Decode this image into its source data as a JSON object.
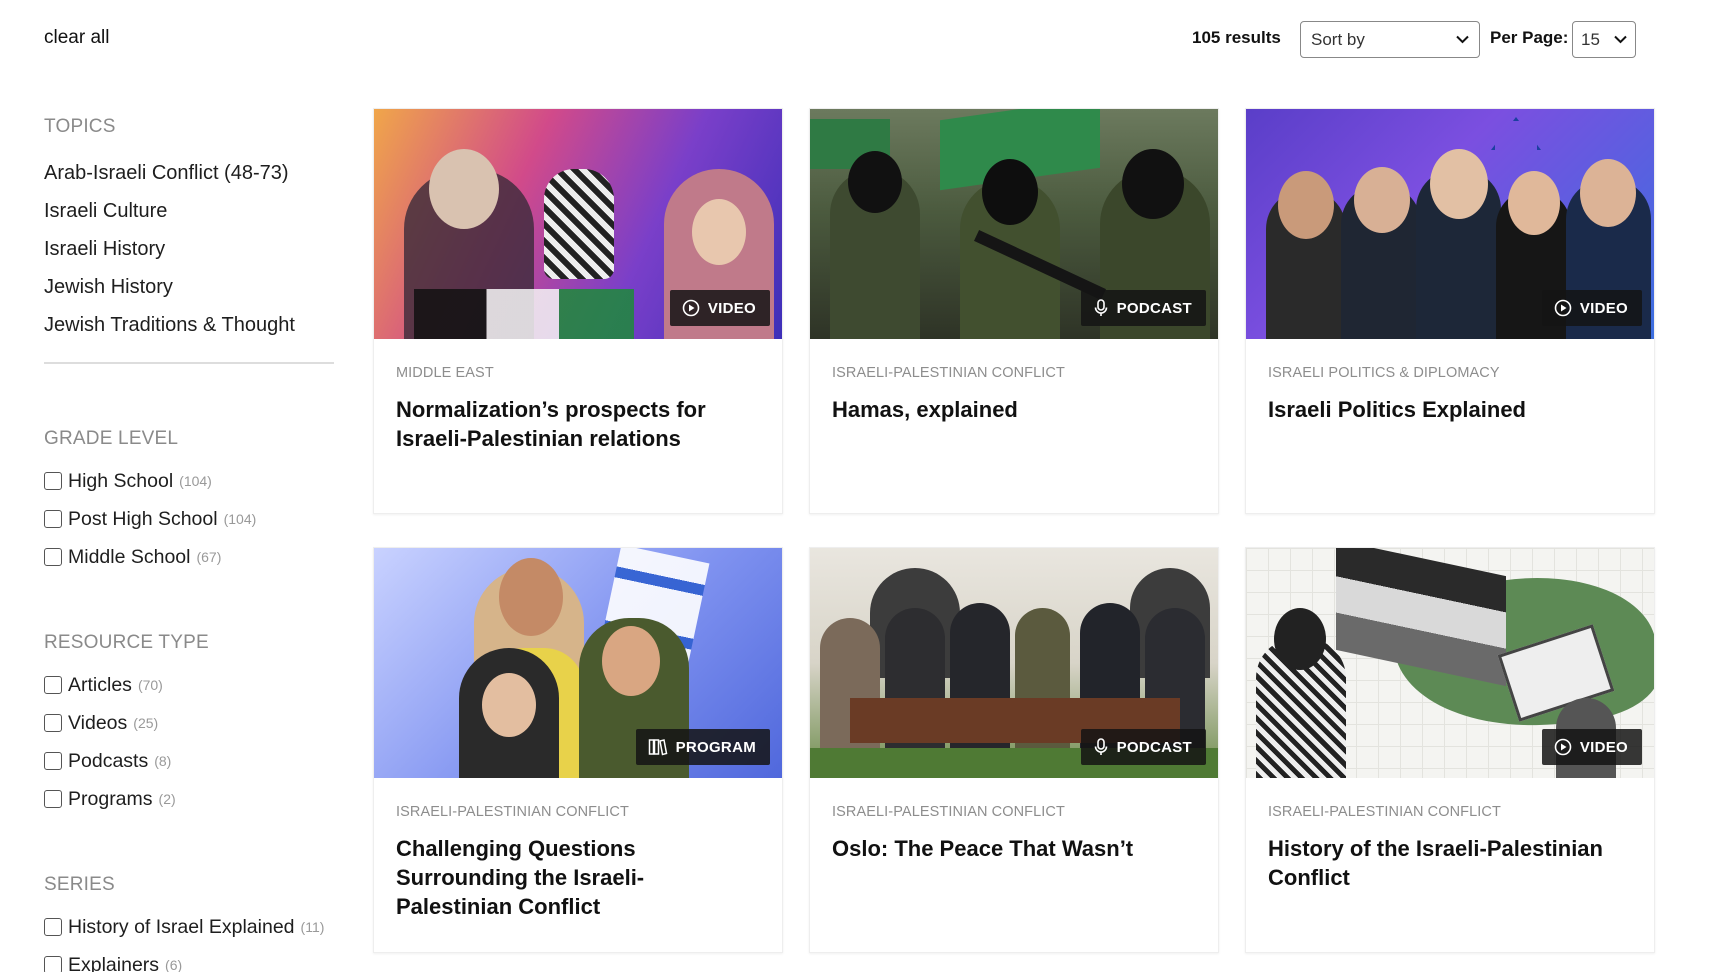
{
  "toolbar": {
    "clear_all": "clear all",
    "results": "105 results",
    "sort_value": "Sort by",
    "per_page_label": "Per Page:",
    "per_page_value": "15"
  },
  "sidebar": {
    "topics_title": "TOPICS",
    "topics": [
      "Arab-Israeli Conflict (48-73)",
      "Israeli Culture",
      "Israeli History",
      "Jewish History",
      "Jewish Traditions & Thought"
    ],
    "grade_title": "GRADE LEVEL",
    "grades": [
      {
        "label": "High School",
        "count": "(104)"
      },
      {
        "label": "Post High School",
        "count": "(104)"
      },
      {
        "label": "Middle School",
        "count": "(67)"
      }
    ],
    "resource_title": "RESOURCE TYPE",
    "resources": [
      {
        "label": "Articles",
        "count": "(70)"
      },
      {
        "label": "Videos",
        "count": "(25)"
      },
      {
        "label": "Podcasts",
        "count": "(8)"
      },
      {
        "label": "Programs",
        "count": "(2)"
      }
    ],
    "series_title": "SERIES",
    "series": [
      {
        "label": "History of Israel Explained",
        "count": "(11)"
      },
      {
        "label": "Explainers",
        "count": "(6)"
      }
    ]
  },
  "cards": [
    {
      "badge": "VIDEO",
      "badge_icon": "play-icon",
      "category": "MIDDLE EAST",
      "title": "Normalization’s prospects for Israeli-Palestinian relations"
    },
    {
      "badge": "PODCAST",
      "badge_icon": "microphone-icon",
      "category": "ISRAELI-PALESTINIAN CONFLICT",
      "title": "Hamas, explained"
    },
    {
      "badge": "VIDEO",
      "badge_icon": "play-icon",
      "category": "ISRAELI POLITICS & DIPLOMACY",
      "title": "Israeli Politics Explained"
    },
    {
      "badge": "PROGRAM",
      "badge_icon": "book-icon",
      "category": "ISRAELI-PALESTINIAN CONFLICT",
      "title": "Challenging Questions Surrounding the Israeli-Palestinian Conflict"
    },
    {
      "badge": "PODCAST",
      "badge_icon": "microphone-icon",
      "category": "ISRAELI-PALESTINIAN CONFLICT",
      "title": "Oslo: The Peace That Wasn’t"
    },
    {
      "badge": "VIDEO",
      "badge_icon": "play-icon",
      "category": "ISRAELI-PALESTINIAN CONFLICT",
      "title": "History of the Israeli-Palestinian Conflict"
    }
  ]
}
